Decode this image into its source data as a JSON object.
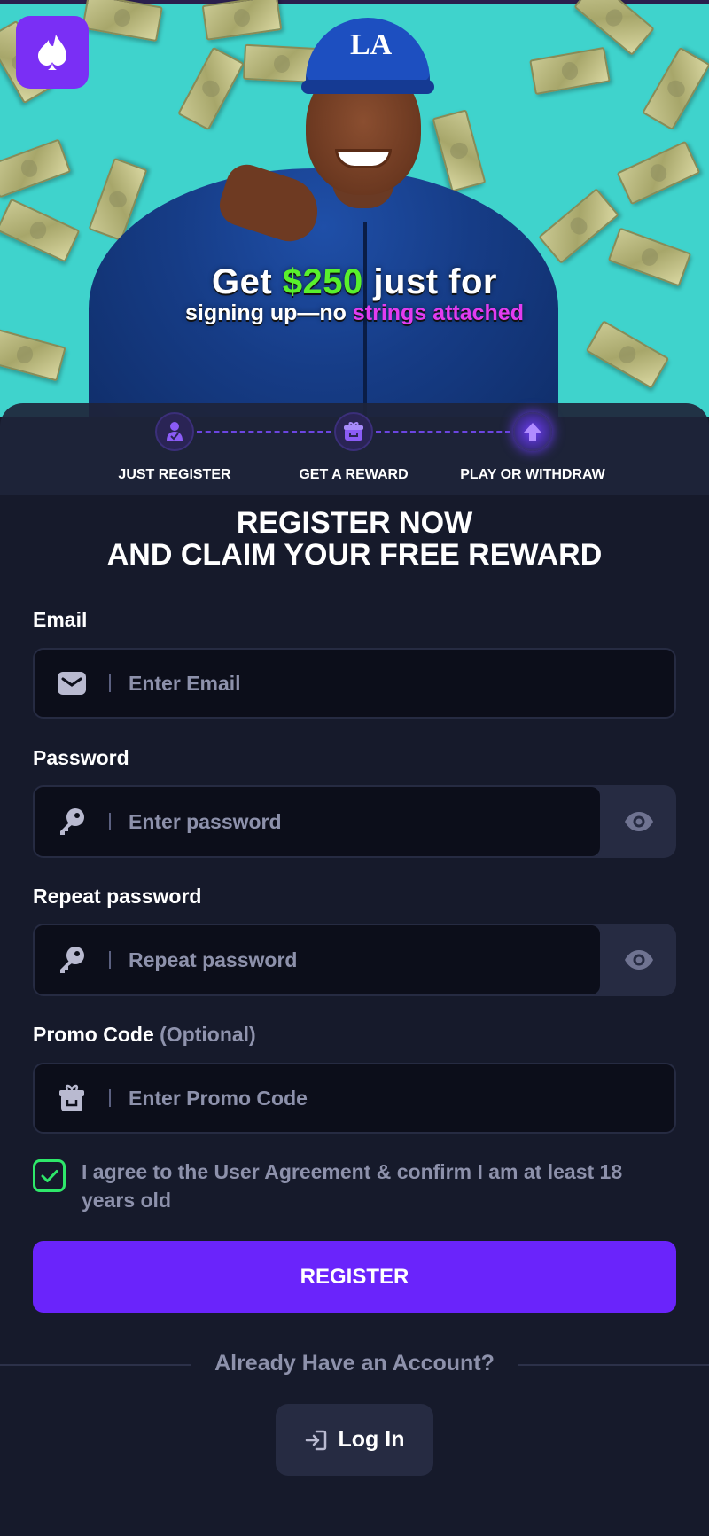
{
  "hero": {
    "headline_prefix": "Get ",
    "headline_amount": "$250",
    "headline_suffix": " just for",
    "subline_prefix": "signing up—no ",
    "subline_highlight": "strings attached",
    "cap_logo": "LA",
    "colors": {
      "background": "#3fd3cc",
      "amount": "#59f02c",
      "highlight": "#e23cf0"
    }
  },
  "brand": {
    "logo_icon": "spade-flame-icon",
    "logo_color": "#7a2ff5"
  },
  "steps": [
    {
      "label": "JUST REGISTER",
      "icon": "user-check-icon"
    },
    {
      "label": "GET A REWARD",
      "icon": "gift-icon"
    },
    {
      "label": "PLAY OR WITHDRAW",
      "icon": "arrow-up-icon"
    }
  ],
  "form": {
    "title_line1": "REGISTER NOW",
    "title_line2": "AND CLAIM YOUR FREE REWARD",
    "email": {
      "label": "Email",
      "placeholder": "Enter Email",
      "value": "",
      "icon": "mail-icon"
    },
    "password": {
      "label": "Password",
      "placeholder": "Enter password",
      "value": "",
      "icon": "key-icon",
      "toggle_icon": "eye-icon"
    },
    "repeat_password": {
      "label": "Repeat password",
      "placeholder": "Repeat password",
      "value": "",
      "icon": "key-icon",
      "toggle_icon": "eye-icon"
    },
    "promo": {
      "label": "Promo Code",
      "optional": "(Optional)",
      "placeholder": "Enter Promo Code",
      "value": "",
      "icon": "gift-icon"
    },
    "agreement": {
      "text": "I agree to the User Agreement & confirm I am at least 18 years old",
      "checked": true
    },
    "register_label": "REGISTER",
    "already_text": "Already Have an Account?",
    "login_label": "Log In",
    "colors": {
      "accent": "#6a24fb",
      "check": "#2ee86a",
      "background": "#161a2b"
    }
  }
}
